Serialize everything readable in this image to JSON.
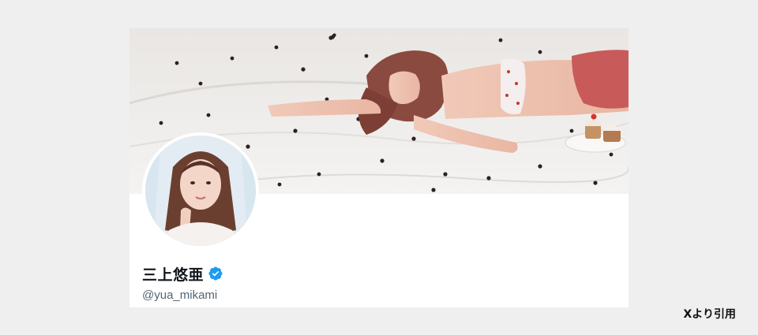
{
  "profile": {
    "display_name": "三上悠亜",
    "handle": "@yua_mikami",
    "verified": true,
    "verified_badge_color": "#1d9bf0"
  },
  "banner": {
    "image": "photo-banner-hearts-bedsheet"
  },
  "avatar": {
    "image": "profile-photo"
  },
  "caption": {
    "source_note": "Xより引用"
  },
  "colors": {
    "page_background": "#efefef",
    "card_background": "#ffffff",
    "name_color": "#0f1419",
    "handle_color": "#536471"
  }
}
